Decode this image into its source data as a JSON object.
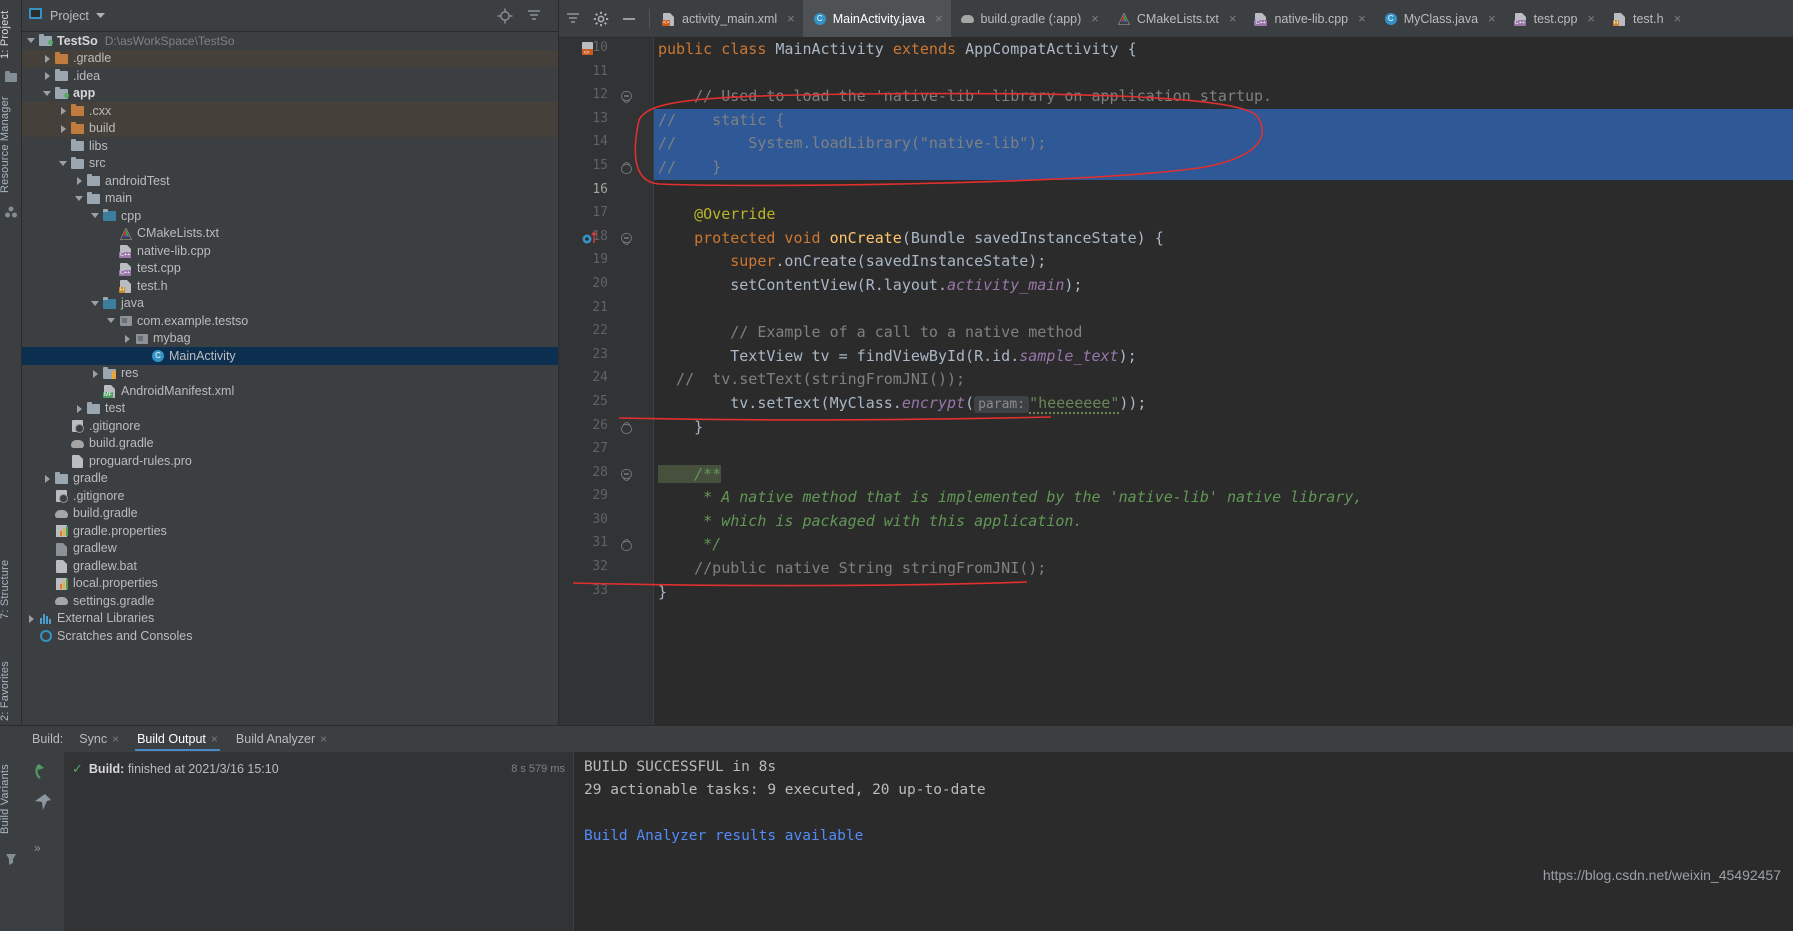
{
  "left_strip": {
    "tabs": [
      {
        "label": "1: Project",
        "name": "tool-tab-project",
        "selected": true
      },
      {
        "label": "Resource Manager",
        "name": "tool-tab-resource-manager",
        "selected": false
      },
      {
        "label": "7: Structure",
        "name": "tool-tab-structure",
        "selected": false
      },
      {
        "label": "2: Favorites",
        "name": "tool-tab-favorites",
        "selected": false
      }
    ]
  },
  "project_panel": {
    "title": "Project",
    "dropdown_icon": "chevron-down-icon",
    "header_icons": [
      "locate-icon",
      "collapse-all-icon",
      "settings-gear-icon",
      "hide-icon"
    ],
    "tree": [
      {
        "depth": 0,
        "label": "TestSo",
        "path": "D:\\asWorkSpace\\TestSo",
        "icon": "module-icon",
        "arrow": "down",
        "bold": true,
        "alt": false,
        "sel": false
      },
      {
        "depth": 1,
        "label": ".gradle",
        "icon": "folder-orange-icon",
        "arrow": "right",
        "alt": true,
        "sel": false
      },
      {
        "depth": 1,
        "label": ".idea",
        "icon": "folder-icon",
        "arrow": "right",
        "alt": false,
        "sel": false
      },
      {
        "depth": 1,
        "label": "app",
        "icon": "module-icon",
        "arrow": "down",
        "bold": true,
        "alt": false,
        "sel": false
      },
      {
        "depth": 2,
        "label": ".cxx",
        "icon": "folder-orange-icon",
        "arrow": "right",
        "alt": true,
        "sel": false
      },
      {
        "depth": 2,
        "label": "build",
        "icon": "folder-orange-icon",
        "arrow": "right",
        "alt": true,
        "sel": false
      },
      {
        "depth": 2,
        "label": "libs",
        "icon": "folder-icon",
        "arrow": "none",
        "alt": false,
        "sel": false
      },
      {
        "depth": 2,
        "label": "src",
        "icon": "folder-icon",
        "arrow": "down",
        "alt": false,
        "sel": false
      },
      {
        "depth": 3,
        "label": "androidTest",
        "icon": "folder-icon",
        "arrow": "right",
        "alt": false,
        "sel": false
      },
      {
        "depth": 3,
        "label": "main",
        "icon": "folder-icon",
        "arrow": "down",
        "alt": false,
        "sel": false
      },
      {
        "depth": 4,
        "label": "cpp",
        "icon": "folder-blue-icon",
        "arrow": "down",
        "alt": false,
        "sel": false
      },
      {
        "depth": 5,
        "label": "CMakeLists.txt",
        "icon": "cmake-icon",
        "arrow": "none",
        "alt": false,
        "sel": false
      },
      {
        "depth": 5,
        "label": "native-lib.cpp",
        "icon": "cpp-file-icon",
        "arrow": "none",
        "alt": false,
        "sel": false
      },
      {
        "depth": 5,
        "label": "test.cpp",
        "icon": "cpp-file-icon",
        "arrow": "none",
        "alt": false,
        "sel": false
      },
      {
        "depth": 5,
        "label": "test.h",
        "icon": "h-file-icon",
        "arrow": "none",
        "alt": false,
        "sel": false
      },
      {
        "depth": 4,
        "label": "java",
        "icon": "folder-blue-icon",
        "arrow": "down",
        "alt": false,
        "sel": false
      },
      {
        "depth": 5,
        "label": "com.example.testso",
        "icon": "package-icon",
        "arrow": "down",
        "alt": false,
        "sel": false
      },
      {
        "depth": 6,
        "label": "mybag",
        "icon": "package-icon",
        "arrow": "right",
        "alt": false,
        "sel": false
      },
      {
        "depth": 7,
        "label": "MainActivity",
        "icon": "java-class-icon",
        "arrow": "none",
        "alt": false,
        "sel": true
      },
      {
        "depth": 4,
        "label": "res",
        "icon": "folder-res-icon",
        "arrow": "right",
        "alt": false,
        "sel": false
      },
      {
        "depth": 4,
        "label": "AndroidManifest.xml",
        "icon": "manifest-file-icon",
        "arrow": "none",
        "alt": false,
        "sel": false
      },
      {
        "depth": 3,
        "label": "test",
        "icon": "folder-icon",
        "arrow": "right",
        "alt": false,
        "sel": false
      },
      {
        "depth": 2,
        "label": ".gitignore",
        "icon": "gitignore-file-icon",
        "arrow": "none",
        "alt": false,
        "sel": false
      },
      {
        "depth": 2,
        "label": "build.gradle",
        "icon": "gradle-file-icon",
        "arrow": "none",
        "alt": false,
        "sel": false
      },
      {
        "depth": 2,
        "label": "proguard-rules.pro",
        "icon": "text-file-icon",
        "arrow": "none",
        "alt": false,
        "sel": false
      },
      {
        "depth": 1,
        "label": "gradle",
        "icon": "folder-icon",
        "arrow": "right",
        "alt": false,
        "sel": false
      },
      {
        "depth": 1,
        "label": ".gitignore",
        "icon": "gitignore-file-icon",
        "arrow": "none",
        "alt": false,
        "sel": false
      },
      {
        "depth": 1,
        "label": "build.gradle",
        "icon": "gradle-file-icon",
        "arrow": "none",
        "alt": false,
        "sel": false
      },
      {
        "depth": 1,
        "label": "gradle.properties",
        "icon": "properties-file-icon",
        "arrow": "none",
        "alt": false,
        "sel": false
      },
      {
        "depth": 1,
        "label": "gradlew",
        "icon": "script-file-icon",
        "arrow": "none",
        "alt": false,
        "sel": false
      },
      {
        "depth": 1,
        "label": "gradlew.bat",
        "icon": "bat-file-icon",
        "arrow": "none",
        "alt": false,
        "sel": false
      },
      {
        "depth": 1,
        "label": "local.properties",
        "icon": "properties-file-icon",
        "arrow": "none",
        "alt": false,
        "sel": false
      },
      {
        "depth": 1,
        "label": "settings.gradle",
        "icon": "gradle-file-icon",
        "arrow": "none",
        "alt": false,
        "sel": false
      },
      {
        "depth": 0,
        "label": "External Libraries",
        "icon": "libraries-icon",
        "arrow": "right",
        "alt": false,
        "sel": false
      },
      {
        "depth": 0,
        "label": "Scratches and Consoles",
        "icon": "scratches-icon",
        "arrow": "none",
        "alt": false,
        "sel": false
      }
    ]
  },
  "editor": {
    "toolbar_icons": [
      "collapse-all-icon",
      "settings-gear-icon",
      "minimize-icon"
    ],
    "tabs": [
      {
        "label": "activity_main.xml",
        "icon": "xml-file-icon",
        "active": false
      },
      {
        "label": "MainActivity.java",
        "icon": "java-class-icon",
        "active": true
      },
      {
        "label": "build.gradle (:app)",
        "icon": "gradle-file-icon",
        "active": false
      },
      {
        "label": "CMakeLists.txt",
        "icon": "cmake-icon",
        "active": false
      },
      {
        "label": "native-lib.cpp",
        "icon": "cpp-file-icon",
        "active": false
      },
      {
        "label": "MyClass.java",
        "icon": "java-class-icon",
        "active": false
      },
      {
        "label": "test.cpp",
        "icon": "cpp-file-icon",
        "active": false
      },
      {
        "label": "test.h",
        "icon": "h-file-icon",
        "active": false
      }
    ],
    "close_glyph": "×",
    "first_line_number": 10,
    "lines": [
      {
        "num": 10,
        "marker": "xml-gutter-icon",
        "fold": "none"
      },
      {
        "num": 11,
        "fold": "none"
      },
      {
        "num": 12,
        "fold": "start"
      },
      {
        "num": 13,
        "fold": "none"
      },
      {
        "num": 14,
        "fold": "none"
      },
      {
        "num": 15,
        "fold": "end"
      },
      {
        "num": 16,
        "fold": "none",
        "current": true
      },
      {
        "num": 17,
        "fold": "none"
      },
      {
        "num": 18,
        "fold": "start",
        "marker": "override-gutter-icon"
      },
      {
        "num": 19,
        "fold": "none"
      },
      {
        "num": 20,
        "fold": "none"
      },
      {
        "num": 21,
        "fold": "none"
      },
      {
        "num": 22,
        "fold": "none"
      },
      {
        "num": 23,
        "fold": "none"
      },
      {
        "num": 24,
        "fold": "none"
      },
      {
        "num": 25,
        "fold": "none"
      },
      {
        "num": 26,
        "fold": "end"
      },
      {
        "num": 27,
        "fold": "none"
      },
      {
        "num": 28,
        "fold": "start"
      },
      {
        "num": 29,
        "fold": "none"
      },
      {
        "num": 30,
        "fold": "none"
      },
      {
        "num": 31,
        "fold": "end"
      },
      {
        "num": 32,
        "fold": "none"
      },
      {
        "num": 33,
        "fold": "none"
      }
    ],
    "code": {
      "l10": "public class MainActivity extends AppCompatActivity {",
      "l12": "    // Used to load the 'native-lib' library on application startup.",
      "l13": "//    static {",
      "l14": "//        System.loadLibrary(\"native-lib\");",
      "l15": "//    }",
      "l17": "    @Override",
      "l18": "    protected void onCreate(Bundle savedInstanceState) {",
      "l19": "        super.onCreate(savedInstanceState);",
      "l20": "        setContentView(R.layout.activity_main);",
      "l22": "        // Example of a call to a native method",
      "l23": "        TextView tv = findViewById(R.id.sample_text);",
      "l24": "  //  tv.setText(stringFromJNI());",
      "l25_a": "        tv.setText(MyClass.",
      "l25_encrypt": "encrypt",
      "l25_hint": "param:",
      "l25_str": "\"heeeeeee\"",
      "l25_tail": "));",
      "l26": "    }",
      "l28": "    /**",
      "l29": "     * A native method that is implemented by the 'native-lib' native library,",
      "l30": "     * which is packaged with this application.",
      "l31": "     */",
      "l32": "    //public native String stringFromJNI();",
      "l33": "}"
    }
  },
  "build_panel": {
    "label": "Build:",
    "tabs": [
      {
        "label": "Sync",
        "active": false,
        "closable": true
      },
      {
        "label": "Build Output",
        "active": true,
        "closable": true
      },
      {
        "label": "Build Analyzer",
        "active": false,
        "closable": true
      }
    ],
    "side_icons": [
      "rerun-icon",
      "pin-icon",
      "expand-icon"
    ],
    "result_row": {
      "check": "✓",
      "title": "Build:",
      "status": "finished",
      "at": "at 2021/3/16 15:10",
      "duration": "8 s 579 ms"
    },
    "console": [
      {
        "text": "BUILD SUCCESSFUL in 8s",
        "link": false
      },
      {
        "text": "29 actionable tasks: 9 executed, 20 up-to-date",
        "link": false
      },
      {
        "text": "",
        "link": false
      },
      {
        "text": "Build Analyzer results available",
        "link": true
      }
    ]
  },
  "bottom_strip": {
    "tabs": [
      {
        "label": "Build Variants"
      }
    ]
  },
  "watermark": "https://blog.csdn.net/weixin_45492457",
  "colors": {
    "accent_blue": "#3592c4",
    "selection_blue": "#2f5896",
    "tree_selection": "#0d2f4f",
    "annotation_red": "#e03030",
    "keyword_orange": "#cc7832",
    "string_green": "#6a8759",
    "comment_grey": "#808080",
    "doc_green": "#629755"
  }
}
